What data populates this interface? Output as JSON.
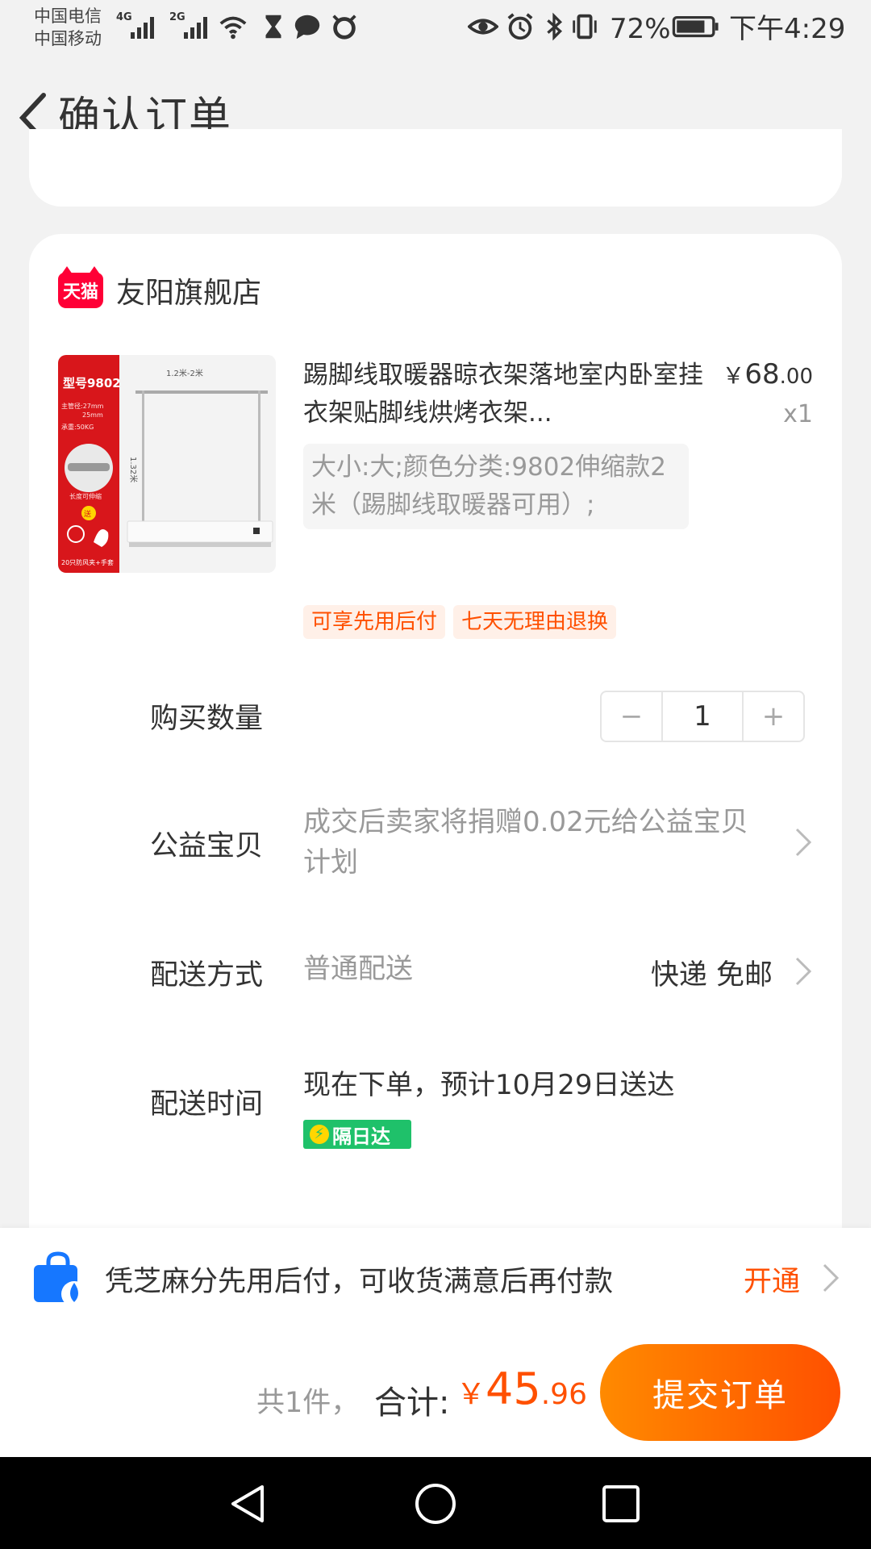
{
  "status_bar": {
    "carrier1": "中国电信",
    "carrier2": "中国移动",
    "net1": "4G",
    "net2": "2G",
    "battery": "72%",
    "time": "下午4:29"
  },
  "nav": {
    "title": "确认订单",
    "back_icon": "chevron-left-icon"
  },
  "shop": {
    "name": "友阳旗舰店",
    "logo_text": "天猫",
    "logo_color": "#ff0036"
  },
  "product": {
    "title": "踢脚线取暖器晾衣架落地室内卧室挂衣架贴脚线烘烤衣架...",
    "price_symbol": "￥",
    "price_int": "68",
    "price_dec": ".00",
    "quantity": "x1",
    "sku": "大小:大;颜色分类:9802伸缩款2米（踢脚线取暖器可用）;",
    "thumb": {
      "model": "型号9802",
      "dims": "1.2米-2米",
      "height": "1.32米",
      "spec1": "主管径:27mm",
      "spec2": "25mm",
      "spec3": "承重:50KG",
      "gift": "送",
      "note1": "长度可伸缩",
      "note2": "20只防风夹+手套"
    },
    "tags": [
      "可享先用后付",
      "七天无理由退换"
    ]
  },
  "rows": {
    "qty_label": "购买数量",
    "qty_value": "1",
    "qty_minus": "−",
    "qty_plus": "+",
    "charity_label": "公益宝贝",
    "charity_value": "成交后卖家将捐赠0.02元给公益宝贝计划",
    "shipping_label": "配送方式",
    "shipping_value": "普通配送",
    "shipping_right": "快递 免邮",
    "time_label": "配送时间",
    "time_value": "现在下单，预计10月29日送达",
    "nextday_badge": "隔日达"
  },
  "pay_later": {
    "text": "凭芝麻分先用后付，可收货满意后再付款",
    "action": "开通",
    "icon": "shopping-bag-icon"
  },
  "submit_bar": {
    "count": "共1件，",
    "total_label": "合计:",
    "currency": "￥",
    "total_int": "45",
    "total_dec": ".96",
    "submit_label": "提交订单",
    "accent": "#ff5000"
  },
  "system_nav": {
    "back": "triangle-back-icon",
    "home": "circle-home-icon",
    "recent": "square-recent-icon"
  }
}
